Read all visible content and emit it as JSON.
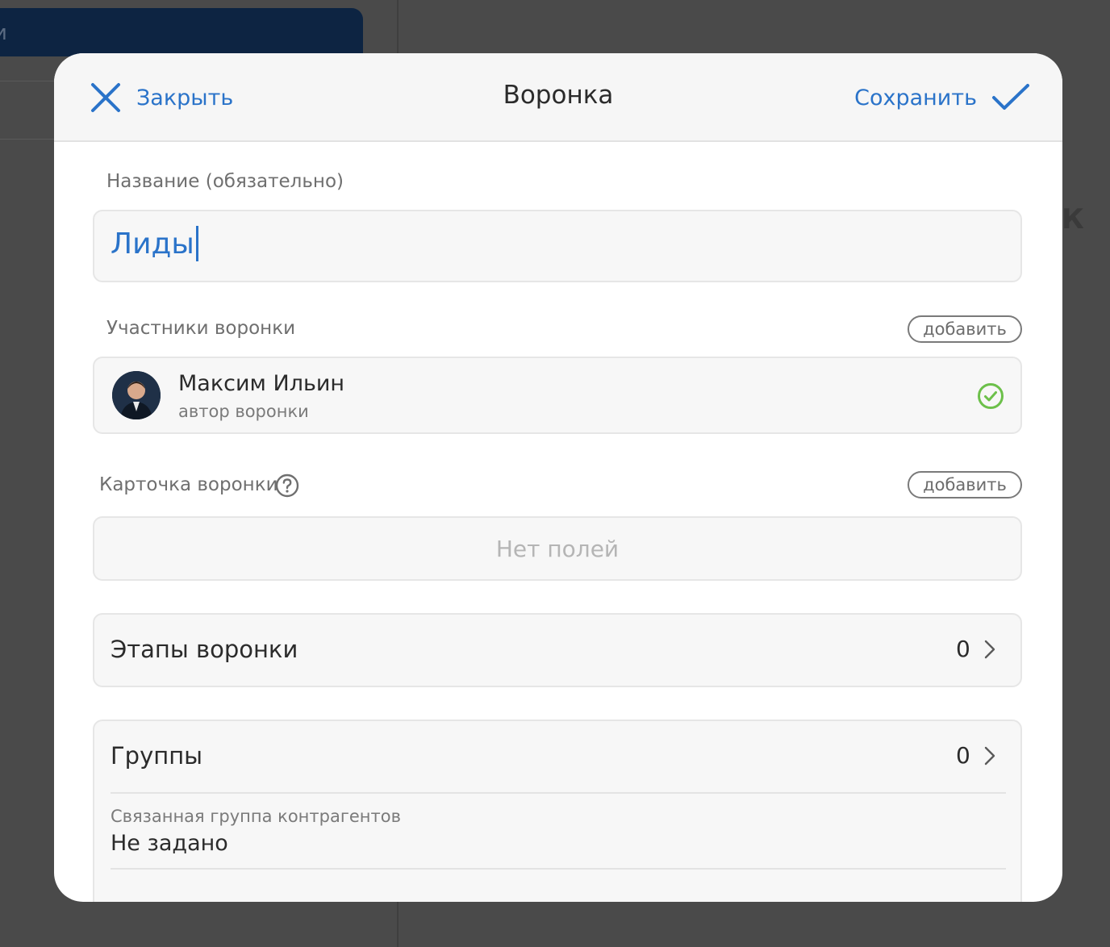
{
  "background": {
    "left_panel_fragment": "и",
    "right_fragment": "К"
  },
  "header": {
    "close_label": "Закрыть",
    "title": "Воронка",
    "save_label": "Сохранить"
  },
  "name_field": {
    "label": "Название (обязательно)",
    "value": "Лиды"
  },
  "members": {
    "label": "Участники воронки",
    "add_label": "добавить",
    "items": [
      {
        "name": "Максим Ильин",
        "role": "автор воронки"
      }
    ]
  },
  "card": {
    "label": "Карточка воронки",
    "add_label": "добавить",
    "empty_text": "Нет полей"
  },
  "stages": {
    "title": "Этапы воронки",
    "count": "0"
  },
  "groups": {
    "title": "Группы",
    "count": "0",
    "linked_label": "Связанная группа контрагентов",
    "linked_value": "Не задано"
  },
  "colors": {
    "accent": "#2a73c9",
    "success": "#6cc04a",
    "overlay": "#4a4a4a"
  }
}
